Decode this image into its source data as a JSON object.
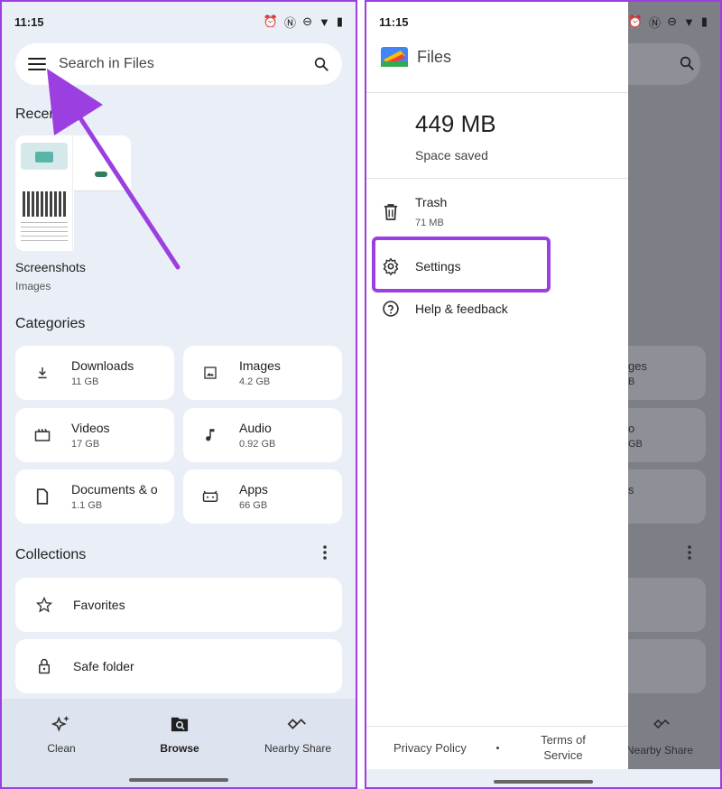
{
  "left": {
    "status": {
      "time": "11:15"
    },
    "search": {
      "placeholder": "Search in Files"
    },
    "recent": {
      "title": "Recent",
      "items": [
        {
          "title": "Screenshots",
          "subtitle": "Images"
        }
      ]
    },
    "categories": {
      "title": "Categories",
      "items": [
        {
          "name": "Downloads",
          "size": "11 GB",
          "icon": "download-icon"
        },
        {
          "name": "Images",
          "size": "4.2 GB",
          "icon": "image-icon"
        },
        {
          "name": "Videos",
          "size": "17 GB",
          "icon": "video-icon"
        },
        {
          "name": "Audio",
          "size": "0.92 GB",
          "icon": "music-note-icon"
        },
        {
          "name": "Documents & other",
          "size": "1.1 GB",
          "icon": "document-icon"
        },
        {
          "name": "Apps",
          "size": "66 GB",
          "icon": "android-icon"
        }
      ]
    },
    "collections": {
      "title": "Collections",
      "items": [
        {
          "name": "Favorites",
          "icon": "star-icon"
        },
        {
          "name": "Safe folder",
          "icon": "lock-icon"
        }
      ]
    },
    "bottom_nav": [
      {
        "label": "Clean",
        "icon": "sparkle-icon",
        "active": false
      },
      {
        "label": "Browse",
        "icon": "browse-icon",
        "active": true
      },
      {
        "label": "Nearby Share",
        "icon": "nearby-share-icon",
        "active": false
      }
    ]
  },
  "right": {
    "status": {
      "time": "11:15"
    },
    "drawer": {
      "app_name": "Files",
      "space_value": "449 MB",
      "space_label": "Space saved",
      "items": [
        {
          "label": "Trash",
          "sub": "71 MB",
          "icon": "trash-icon"
        },
        {
          "label": "Settings",
          "icon": "gear-icon"
        },
        {
          "label": "Help & feedback",
          "icon": "help-icon"
        }
      ],
      "footer": {
        "privacy": "Privacy Policy",
        "terms": "Terms of Service"
      }
    },
    "behind": {
      "labels": [
        "ges",
        "B",
        "o",
        "GB",
        "s",
        "Nearby Share"
      ]
    }
  },
  "colors": {
    "highlight": "#9b3fe0",
    "background": "#eaeef7",
    "card": "#ffffff",
    "scrim": "#7d7f86"
  }
}
